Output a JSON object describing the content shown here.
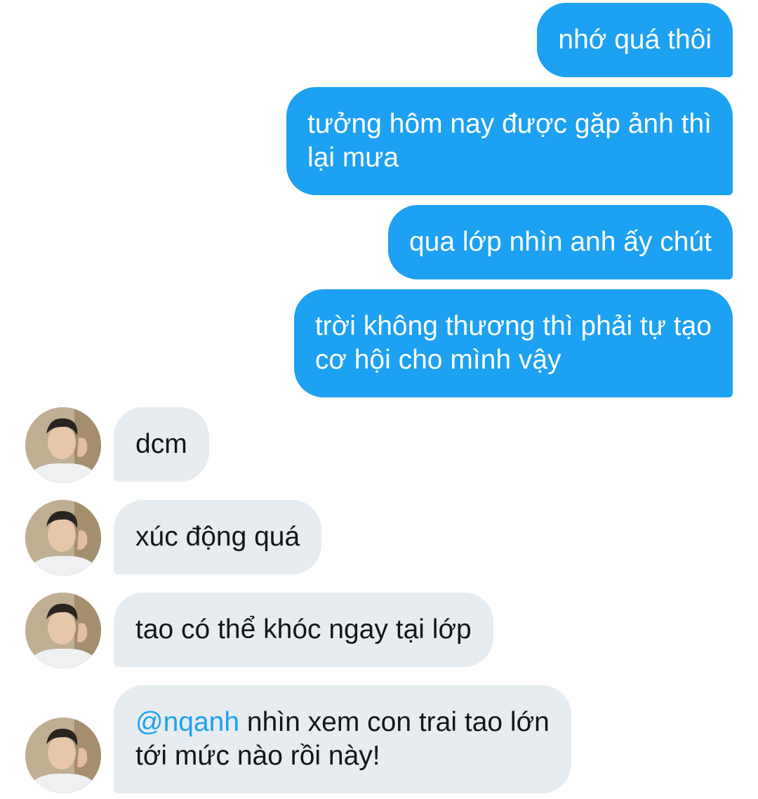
{
  "conversation": {
    "sent": [
      {
        "lines": [
          "nhớ quá thôi"
        ]
      },
      {
        "lines": [
          "tưởng hôm nay được gặp ảnh thì",
          "lại mưa"
        ]
      },
      {
        "lines": [
          "qua lớp nhìn anh ấy chút"
        ]
      },
      {
        "lines": [
          "trời không thương thì phải tự tạo",
          "cơ hội cho mình vậy"
        ]
      }
    ],
    "received": [
      {
        "text": "dcm"
      },
      {
        "text": "xúc động quá"
      },
      {
        "text": "tao có thể khóc ngay tại lớp"
      },
      {
        "mention": "@nqanh",
        "text_after_mention": " nhìn xem con trai tao lớn",
        "line2": "tới mức nào rồi này!"
      }
    ]
  },
  "colors": {
    "sent_bubble": "#1da1f2",
    "received_bubble": "#e6ecf0",
    "mention": "#1da1f2"
  },
  "icons": {
    "avatar": "user-avatar-photo"
  }
}
